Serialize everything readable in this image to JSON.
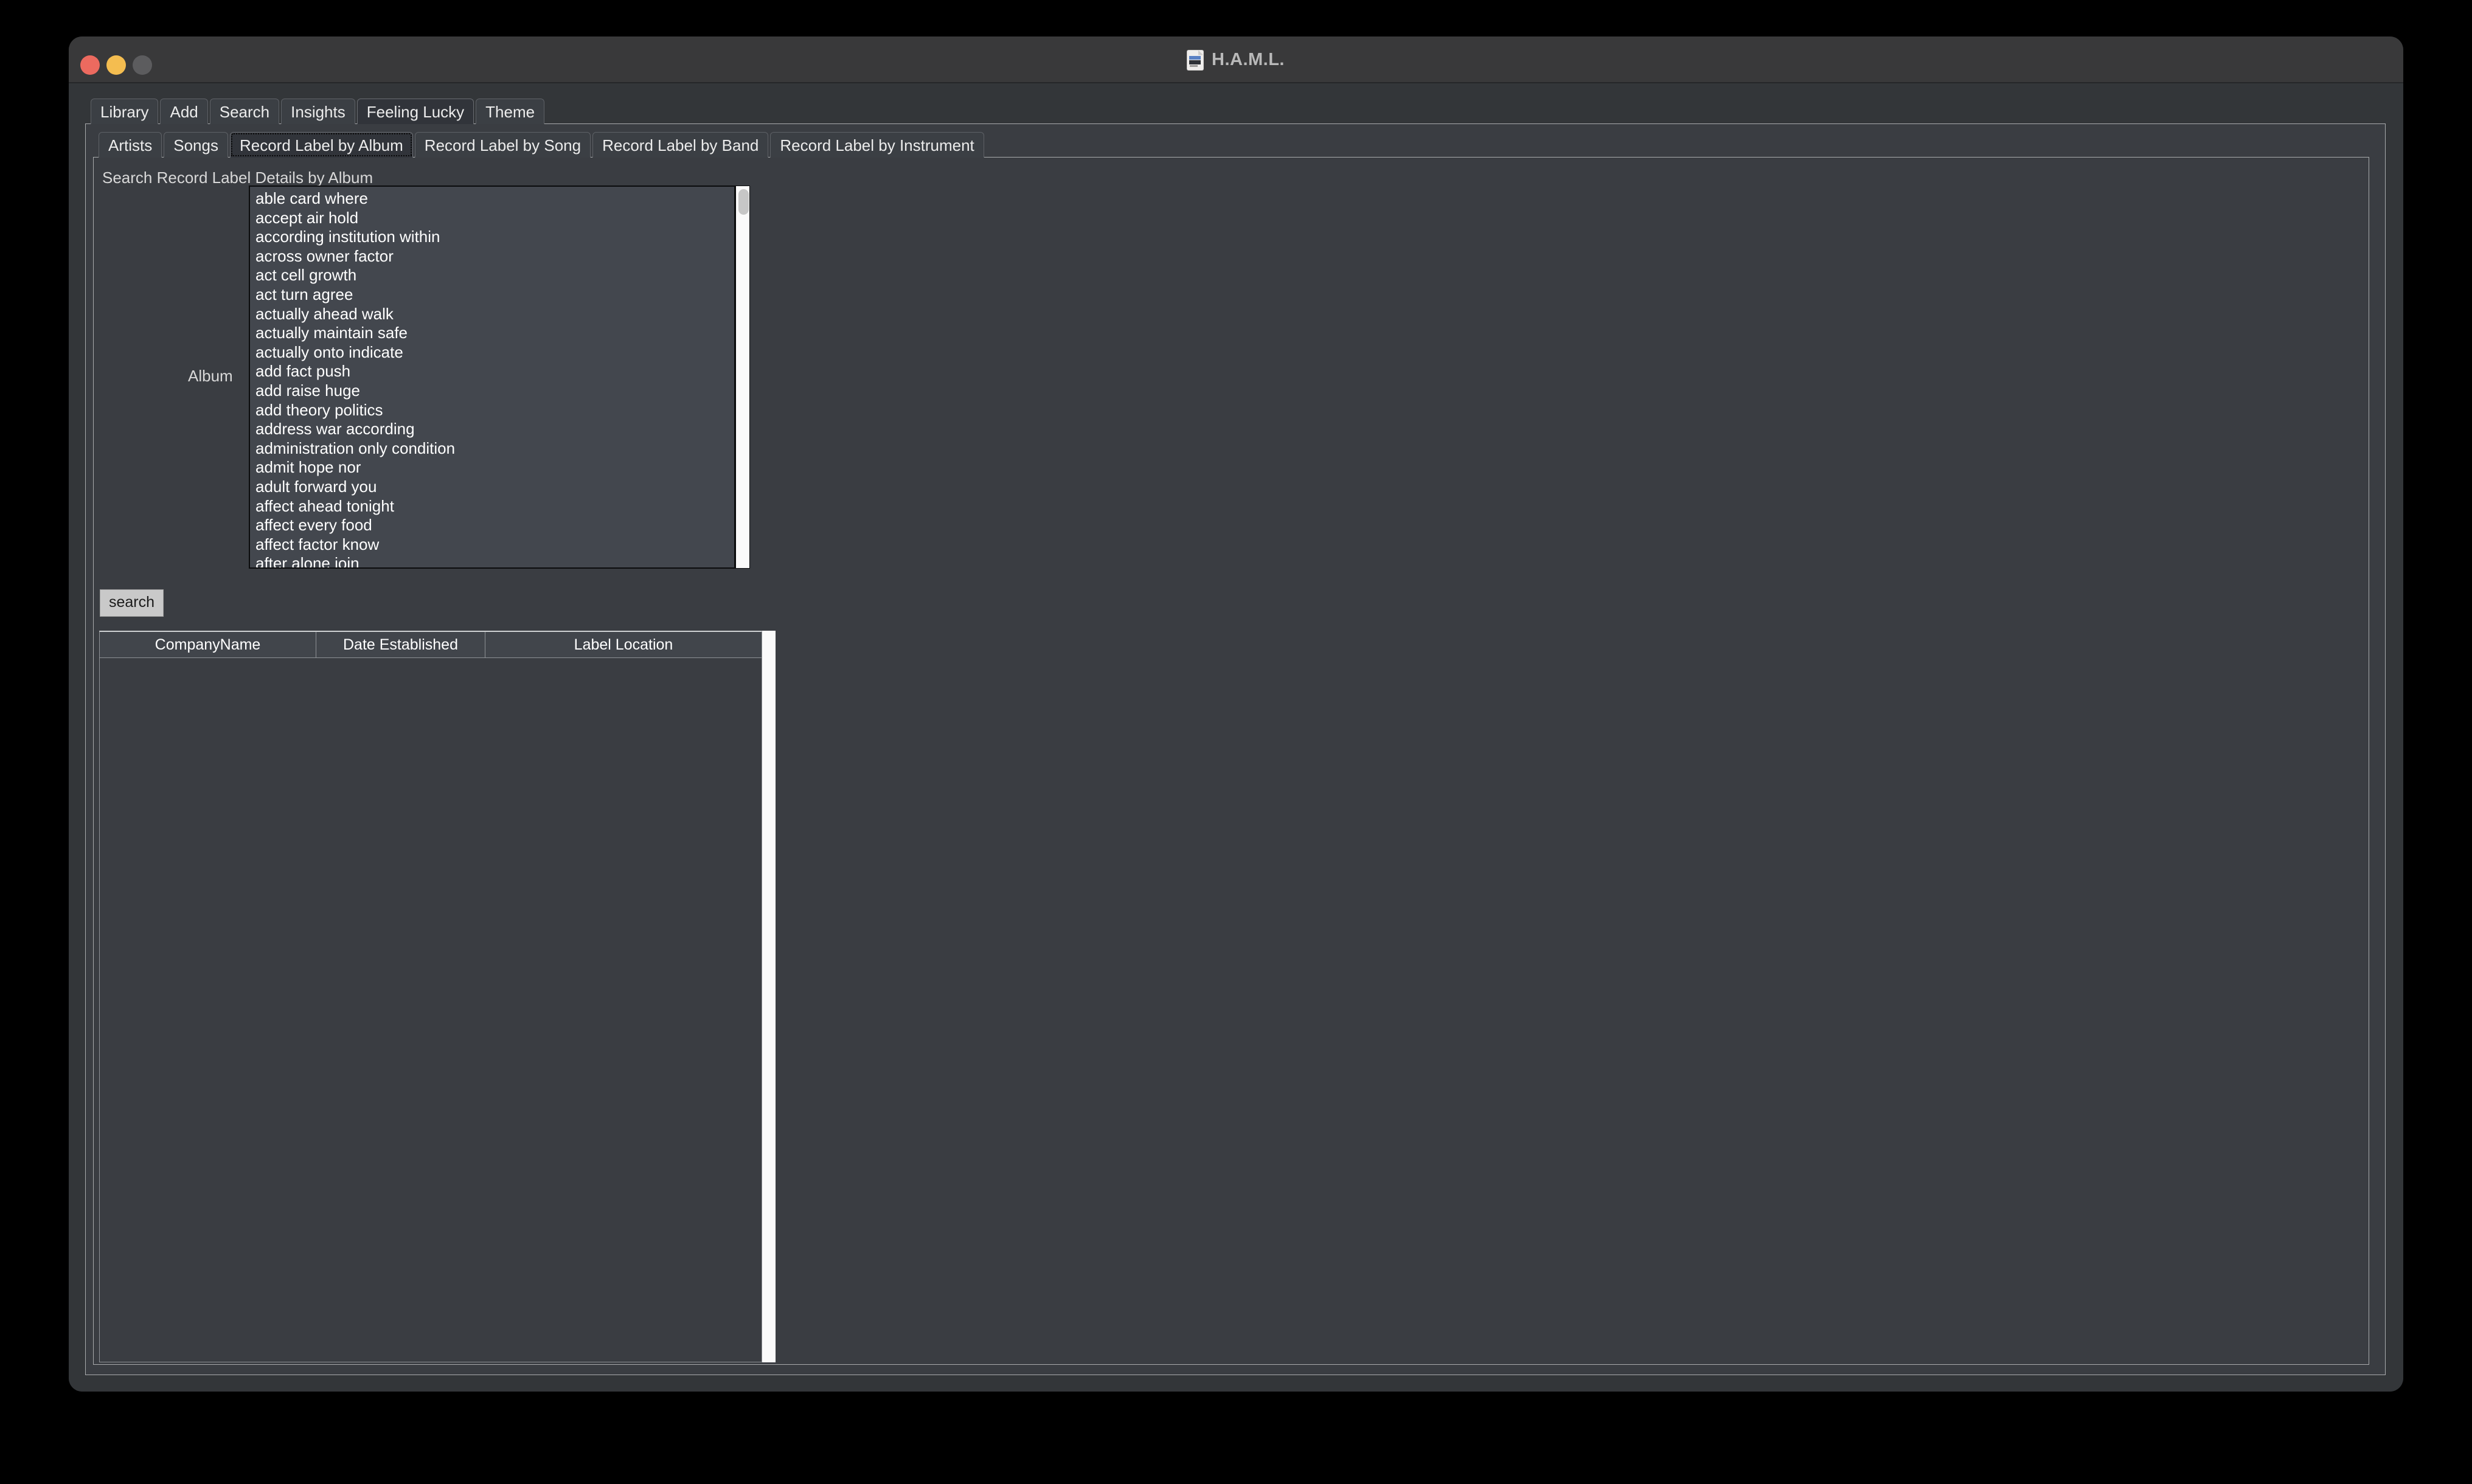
{
  "window": {
    "title": "H.A.M.L.",
    "icon": "document-icon",
    "controls": {
      "close": "close-button",
      "minimize": "minimize-button",
      "zoom": "zoom-button"
    },
    "colors": {
      "close": "#ec6a5f",
      "minimize": "#f4bd50",
      "zoom": "#5c5c5e",
      "window_bg": "#333639",
      "titlebar_bg": "#39393a",
      "page_bg": "#3a3d42",
      "tab_bg": "#3b3f44",
      "tab_selected_bg": "#31343a",
      "list_bg": "#43474e",
      "text": "#ececec",
      "button_bg": "#c9c9c9"
    }
  },
  "primary_tabs": {
    "items": [
      {
        "label": "Library",
        "selected": false
      },
      {
        "label": "Add",
        "selected": false
      },
      {
        "label": "Search",
        "selected": false
      },
      {
        "label": "Insights",
        "selected": false
      },
      {
        "label": "Feeling Lucky",
        "selected": true
      },
      {
        "label": "Theme",
        "selected": false
      }
    ]
  },
  "secondary_tabs": {
    "items": [
      {
        "label": "Artists",
        "selected": false,
        "focused": false
      },
      {
        "label": "Songs",
        "selected": false,
        "focused": false
      },
      {
        "label": "Record Label by Album",
        "selected": true,
        "focused": true
      },
      {
        "label": "Record Label by Song",
        "selected": false,
        "focused": false
      },
      {
        "label": "Record Label by Band",
        "selected": false,
        "focused": false
      },
      {
        "label": "Record Label by Instrument",
        "selected": false,
        "focused": false
      }
    ]
  },
  "panel": {
    "heading": "Search Record Label Details by Album",
    "album_field_label": "Album",
    "album_options": [
      "able card where",
      "accept air hold",
      "according institution within",
      "across owner factor",
      "act cell growth",
      "act turn agree",
      "actually ahead walk",
      "actually maintain safe",
      "actually onto indicate",
      "add fact push",
      "add raise huge",
      "add theory politics",
      "address war according",
      "administration only condition",
      "admit hope nor",
      "adult forward you",
      "affect ahead tonight",
      "affect every food",
      "affect factor know",
      "after alone join"
    ],
    "search_button_label": "search"
  },
  "results": {
    "columns": [
      "CompanyName",
      "Date Established",
      "Label Location"
    ],
    "rows": []
  }
}
